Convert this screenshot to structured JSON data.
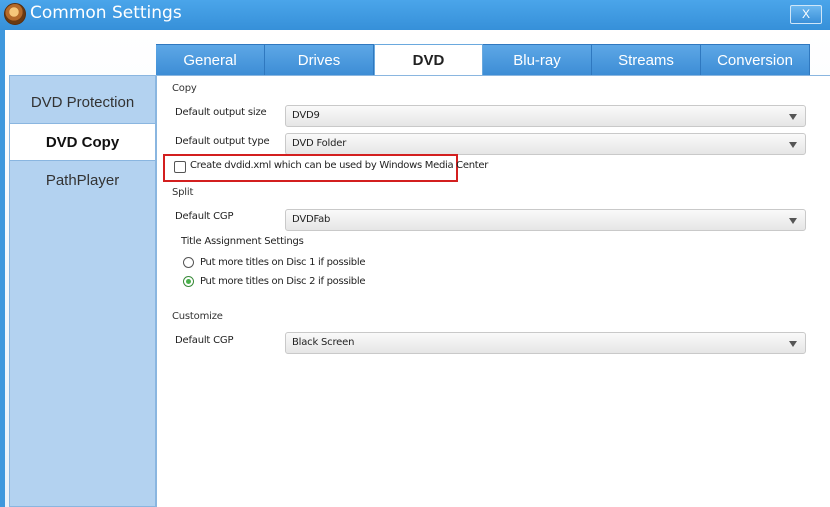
{
  "window": {
    "title": "Common Settings",
    "close_label": "X"
  },
  "tabs": [
    {
      "label": "General",
      "active": false
    },
    {
      "label": "Drives",
      "active": false
    },
    {
      "label": "DVD",
      "active": true
    },
    {
      "label": "Blu-ray",
      "active": false
    },
    {
      "label": "Streams",
      "active": false
    },
    {
      "label": "Conversion",
      "active": false
    }
  ],
  "sidebar": {
    "items": [
      {
        "label": "DVD Protection",
        "active": false
      },
      {
        "label": "DVD Copy",
        "active": true
      },
      {
        "label": "PathPlayer",
        "active": false
      }
    ]
  },
  "copy": {
    "section_label": "Copy",
    "output_size_label": "Default output size",
    "output_size_value": "DVD9",
    "output_type_label": "Default output type",
    "output_type_value": "DVD Folder",
    "dvdid_checkbox_label": "Create dvdid.xml which can be used by Windows Media Center",
    "dvdid_checked": false
  },
  "split": {
    "section_label": "Split",
    "cgp_label": "Default CGP",
    "cgp_value": "DVDFab",
    "title_assignment_label": "Title Assignment Settings",
    "radio_disc1_label": "Put more titles on Disc 1 if possible",
    "radio_disc2_label": "Put more titles on Disc 2 if possible",
    "selected_option": "disc2"
  },
  "customize": {
    "section_label": "Customize",
    "cgp_label": "Default CGP",
    "cgp_value": "Black Screen"
  },
  "colors": {
    "titlebar": "#3f98dd",
    "sidebar": "#b3d2f0",
    "highlight_border": "#d31f1f",
    "radio_selected": "#49b04a"
  }
}
